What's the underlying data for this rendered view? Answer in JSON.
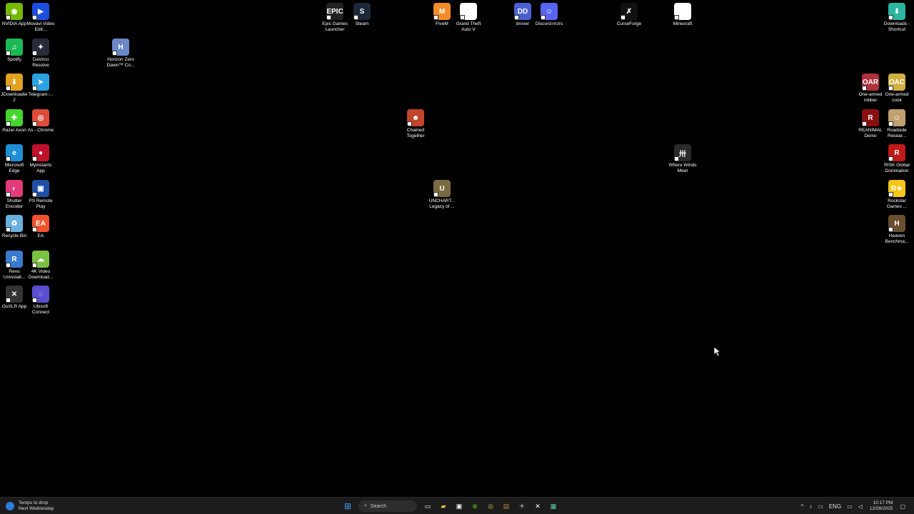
{
  "desktop": {
    "icons": [
      {
        "label": "NVIDIA App",
        "color": "#76b900",
        "glyph": "◉"
      },
      {
        "label": "Movavi Video Edit...",
        "color": "#1d4ee0",
        "glyph": "▶"
      },
      {
        "label": "Spotify",
        "color": "#1db954",
        "glyph": "♫"
      },
      {
        "label": "DaVinci Resolve",
        "color": "#2a2a3a",
        "glyph": "✦"
      },
      {
        "label": "JDownloader 2",
        "color": "#e0a020",
        "glyph": "⬇"
      },
      {
        "label": "Telegram-...",
        "color": "#2aa3e0",
        "glyph": "➤"
      },
      {
        "label": "Razer Axon",
        "color": "#44d62c",
        "glyph": "✚"
      },
      {
        "label": "As - Chrome",
        "color": "#dd4b39",
        "glyph": "◎"
      },
      {
        "label": "Microsoft Edge",
        "color": "#1f8fd6",
        "glyph": "e"
      },
      {
        "label": "Myinstants App",
        "color": "#c0102a",
        "glyph": "●"
      },
      {
        "label": "Shutter Encoder",
        "color": "#e33b7a",
        "glyph": "◐"
      },
      {
        "label": "PS Remote Play",
        "color": "#1f4fa3",
        "glyph": "▣"
      },
      {
        "label": "Recycle Bin",
        "color": "#6ab0e0",
        "glyph": "♻"
      },
      {
        "label": "EA",
        "color": "#f0522b",
        "glyph": "EA"
      },
      {
        "label": "Revo Uninstall...",
        "color": "#3a7bd0",
        "glyph": "R"
      },
      {
        "label": "4K Video Download...",
        "color": "#7bc043",
        "glyph": "☁"
      },
      {
        "label": "GoXLR App",
        "color": "#333333",
        "glyph": "✕"
      },
      {
        "label": "Ubisoft Connect",
        "color": "#5a4fcf",
        "glyph": "◌"
      },
      {
        "label": "Horizon Zero Dawn™ Co...",
        "color": "#6a88c8",
        "glyph": "H"
      },
      {
        "label": "Epic Games Launcher",
        "color": "#222222",
        "glyph": "EPIC"
      },
      {
        "label": "Steam",
        "color": "#1b2838",
        "glyph": "S"
      },
      {
        "label": "FiveM",
        "color": "#f28c28",
        "glyph": "M"
      },
      {
        "label": "Grand Theft Auto V",
        "color": "#ffffff",
        "glyph": ""
      },
      {
        "label": "drover",
        "color": "#4a5fd0",
        "glyph": "DD"
      },
      {
        "label": "Discord-mzrs",
        "color": "#5865f2",
        "glyph": "☺"
      },
      {
        "label": "CurseForge",
        "color": "#111111",
        "glyph": "✗"
      },
      {
        "label": "Minecraft",
        "color": "#ffffff",
        "glyph": ""
      },
      {
        "label": "Downloads - Shortcut",
        "color": "#2bb6a0",
        "glyph": "⬇"
      },
      {
        "label": "Chained Together",
        "color": "#c0452a",
        "glyph": "☻"
      },
      {
        "label": "UNCHART... Legacy of ...",
        "color": "#7a6a40",
        "glyph": "U"
      },
      {
        "label": "Where Winds Meet",
        "color": "#2a2a2a",
        "glyph": "卅"
      },
      {
        "label": "One-armed robber",
        "color": "#b0303a",
        "glyph": "OAR"
      },
      {
        "label": "One-armed cook",
        "color": "#d0b040",
        "glyph": "OAC"
      },
      {
        "label": "REANIMAL Demo",
        "color": "#8a1010",
        "glyph": "R"
      },
      {
        "label": "Roadside Resear...",
        "color": "#c0a070",
        "glyph": "☺"
      },
      {
        "label": "RISK Global Domination",
        "color": "#c01a1a",
        "glyph": "R"
      },
      {
        "label": "Rockstar Games ...",
        "color": "#f5c518",
        "glyph": "R★"
      },
      {
        "label": "Heaven Benchma...",
        "color": "#6a5030",
        "glyph": "H"
      }
    ]
  },
  "taskbar": {
    "weather": {
      "line1": "Temps to drop",
      "line2": "Next Wednesday"
    },
    "search": {
      "placeholder": "Search"
    },
    "tray": {
      "language": "ENG",
      "time": "10:17 PM",
      "date": "12/28/2025"
    }
  }
}
